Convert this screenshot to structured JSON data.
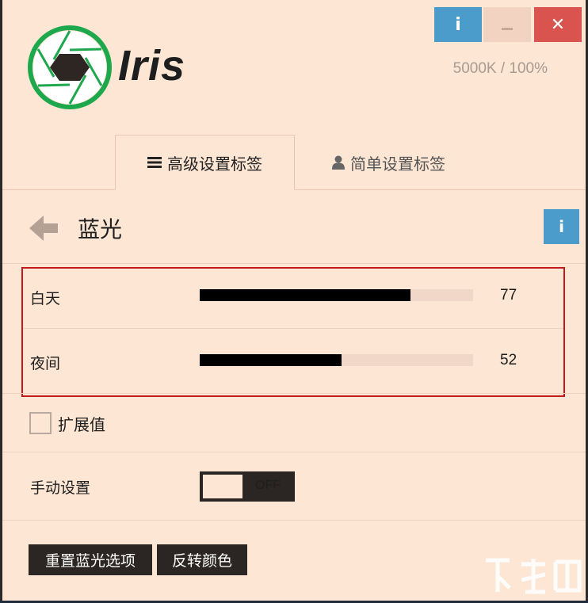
{
  "window": {
    "info_icon": "info-icon",
    "minimize_icon": "minimize-icon",
    "close_icon": "close-icon",
    "temp_readout": "5000K / 100%"
  },
  "brand": {
    "name": "Iris",
    "ring_color": "#1ea84d"
  },
  "tabs": [
    {
      "label": "高级设置标签",
      "icon": "menu-icon",
      "active": true
    },
    {
      "label": "简单设置标签",
      "icon": "user-icon",
      "active": false
    }
  ],
  "section": {
    "title": "蓝光",
    "back_icon": "back-arrow-icon",
    "info_icon": "info-icon"
  },
  "sliders": [
    {
      "label": "白天",
      "value": "77",
      "fill": 0.77
    },
    {
      "label": "夜间",
      "value": "52",
      "fill": 0.52
    }
  ],
  "extended": {
    "label": "扩展值",
    "checked": false
  },
  "manual": {
    "label": "手动设置",
    "state": "OFF"
  },
  "buttons": {
    "reset": "重置蓝光选项",
    "invert": "反转颜色"
  },
  "colors": {
    "background": "#fde6d3",
    "info_blue": "#4b9bcb",
    "close_red": "#d9534f",
    "dark": "#2b2623",
    "highlight_red": "#c31b1b"
  }
}
